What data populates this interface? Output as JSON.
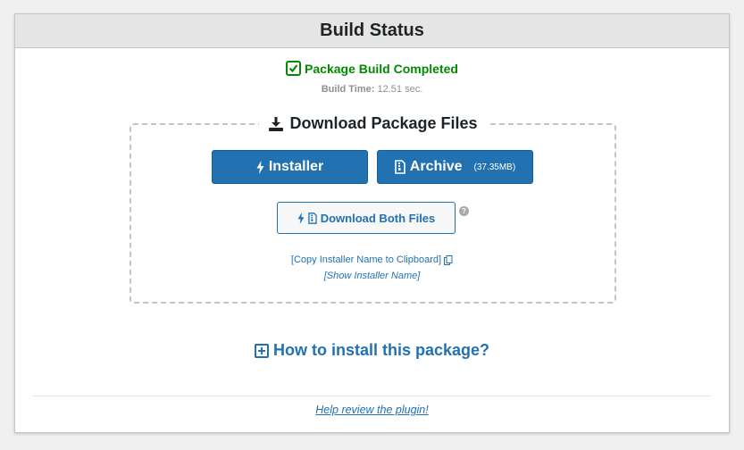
{
  "panel": {
    "title": "Build Status"
  },
  "status": {
    "message": "Package Build Completed",
    "build_time_label": "Build Time:",
    "build_time_value": "12.51 sec."
  },
  "download": {
    "legend": "Download Package Files",
    "installer_label": "Installer",
    "archive_label": "Archive",
    "archive_size": "(37.35MB)",
    "both_label": "Download Both Files",
    "help_glyph": "?",
    "copy_link": "[Copy Installer Name to Clipboard]",
    "show_link": "[Show Installer Name]"
  },
  "howto": {
    "label": "How to install this package?"
  },
  "footer": {
    "review_link": "Help review the plugin!"
  },
  "colors": {
    "primary": "#2271b1",
    "success": "#008a00",
    "muted": "#8c8f94",
    "header_bg": "#e5e5e5"
  },
  "icons": {
    "status": "check-square-icon",
    "download": "download-icon",
    "installer": "bolt-icon",
    "archive": "file-archive-icon",
    "help": "help-icon",
    "copy": "copy-icon",
    "howto": "plus-square-icon"
  }
}
